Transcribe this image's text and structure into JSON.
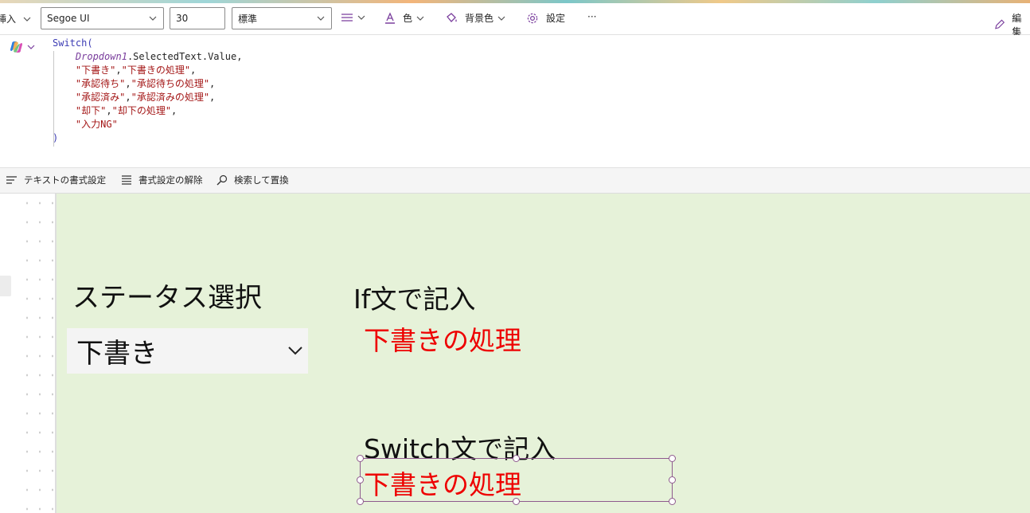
{
  "toolbar": {
    "insert_label": "挿入",
    "font_family": "Segoe UI",
    "font_size": "30",
    "font_weight": "標準",
    "color_label": "色",
    "fill_label": "背景色",
    "settings_label": "設定",
    "more_label": "···",
    "edit_label": "編集"
  },
  "formula": {
    "lines": [
      [
        {
          "t": "Switch(",
          "c": "fn"
        }
      ],
      [
        {
          "t": "    "
        },
        {
          "t": "Dropdown1",
          "c": "ctl"
        },
        {
          "t": ".SelectedText.Value,",
          "c": "prop"
        }
      ],
      [
        {
          "t": "    "
        },
        {
          "t": "\"下書き\"",
          "c": "str"
        },
        {
          "t": ",",
          "c": "pun"
        },
        {
          "t": "\"下書きの処理\"",
          "c": "str"
        },
        {
          "t": ",",
          "c": "pun"
        }
      ],
      [
        {
          "t": "    "
        },
        {
          "t": "\"承認待ち\"",
          "c": "str"
        },
        {
          "t": ",",
          "c": "pun"
        },
        {
          "t": "\"承認待ちの処理\"",
          "c": "str"
        },
        {
          "t": ",",
          "c": "pun"
        }
      ],
      [
        {
          "t": "    "
        },
        {
          "t": "\"承認済み\"",
          "c": "str"
        },
        {
          "t": ",",
          "c": "pun"
        },
        {
          "t": "\"承認済みの処理\"",
          "c": "str"
        },
        {
          "t": ",",
          "c": "pun"
        }
      ],
      [
        {
          "t": "    "
        },
        {
          "t": "\"却下\"",
          "c": "str"
        },
        {
          "t": ",",
          "c": "pun"
        },
        {
          "t": "\"却下の処理\"",
          "c": "str"
        },
        {
          "t": ",",
          "c": "pun"
        }
      ],
      [
        {
          "t": "    "
        },
        {
          "t": "\"入力NG\"",
          "c": "str"
        }
      ],
      [
        {
          "t": ")",
          "c": "fn"
        }
      ]
    ]
  },
  "format_bar": {
    "format_text": "テキストの書式設定",
    "remove_format": "書式設定の解除",
    "find_replace": "検索して置換"
  },
  "canvas": {
    "status_label": "ステータス選択",
    "dropdown_value": "下書き",
    "if_label": "If文で記入",
    "if_result": "下書きの処理",
    "switch_label": "Switch文で記入",
    "switch_result": "下書きの処理"
  },
  "colors": {
    "result_text": "#ee0000",
    "canvas_bg": "#e6f2d9",
    "selection": "#8e5a8e"
  }
}
